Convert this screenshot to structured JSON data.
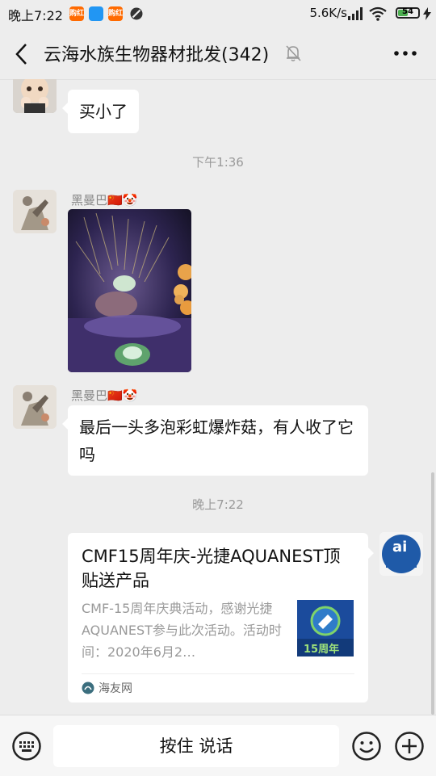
{
  "status_bar": {
    "time": "晚上7:22",
    "network_speed": "5.6K/s",
    "battery_level": "54",
    "battery_percent": 54,
    "app_badges": [
      {
        "name": "taobao-badge",
        "label": "购红",
        "color": "#ff6a00"
      },
      {
        "name": "blue-app-badge",
        "label": "",
        "color": "#2196f3"
      },
      {
        "name": "taobao-badge-2",
        "label": "购红",
        "color": "#ff6a00"
      }
    ]
  },
  "header": {
    "title": "云海水族生物器材批发(342)",
    "back_icon": "chevron-left-icon",
    "mute_icon": "bell-off-icon",
    "more_icon": "more-dots-icon"
  },
  "messages": {
    "m1": {
      "text": "买小了"
    },
    "ts1": "下午1:36",
    "m2": {
      "sender": "黑曼巴🇨🇳🤡",
      "type": "image"
    },
    "m3": {
      "sender": "黑曼巴🇨🇳🤡",
      "text": "最后一头多泡彩虹爆炸菇，有人收了它吗"
    },
    "ts2": "晚上7:22"
  },
  "card": {
    "title": "CMF15周年庆-光捷AQUANEST顶贴送产品",
    "description": "CMF-15周年庆典活动，感谢光捷AQUANEST参与此次活动。活动时间：2020年6月2…",
    "thumb_text": "15周年",
    "source": "海友网",
    "avatar_text": "ai"
  },
  "input_bar": {
    "voice_label": "按住 说话",
    "keyboard_icon": "keyboard-icon",
    "emoji_icon": "emoji-icon",
    "plus_icon": "plus-icon"
  }
}
